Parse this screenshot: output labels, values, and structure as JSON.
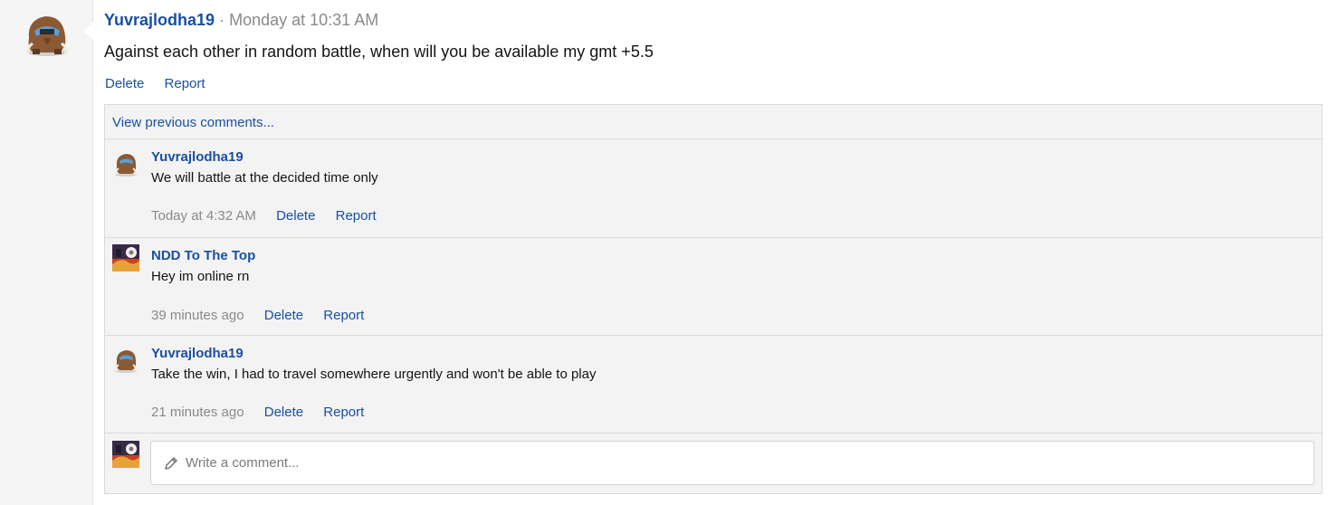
{
  "post": {
    "author": "Yuvrajlodha19",
    "separator": "·",
    "time": "Monday at 10:31 AM",
    "body": "Against each other in random battle, when will you be available my gmt +5.5",
    "actions": {
      "delete": "Delete",
      "report": "Report"
    }
  },
  "comments": {
    "view_previous": "View previous comments...",
    "items": [
      {
        "author": "Yuvrajlodha19",
        "text": "We will battle at the decided time only",
        "time": "Today at 4:32 AM",
        "delete": "Delete",
        "report": "Report",
        "avatar": "mamoswine-avatar"
      },
      {
        "author": "NDD To The Top",
        "text": "Hey im online rn",
        "time": "39 minutes ago",
        "delete": "Delete",
        "report": "Report",
        "avatar": "battle-scene-avatar"
      },
      {
        "author": "Yuvrajlodha19",
        "text": "Take the win, I had to travel somewhere urgently and won't be able to play",
        "time": "21 minutes ago",
        "delete": "Delete",
        "report": "Report",
        "avatar": "mamoswine-avatar"
      }
    ],
    "write": {
      "placeholder": "Write a comment...",
      "icon": "pencil-icon"
    }
  },
  "colors": {
    "link": "#1a4fa3",
    "muted": "#8a8a8a",
    "panel": "#f3f3f3",
    "border": "#dadada"
  }
}
